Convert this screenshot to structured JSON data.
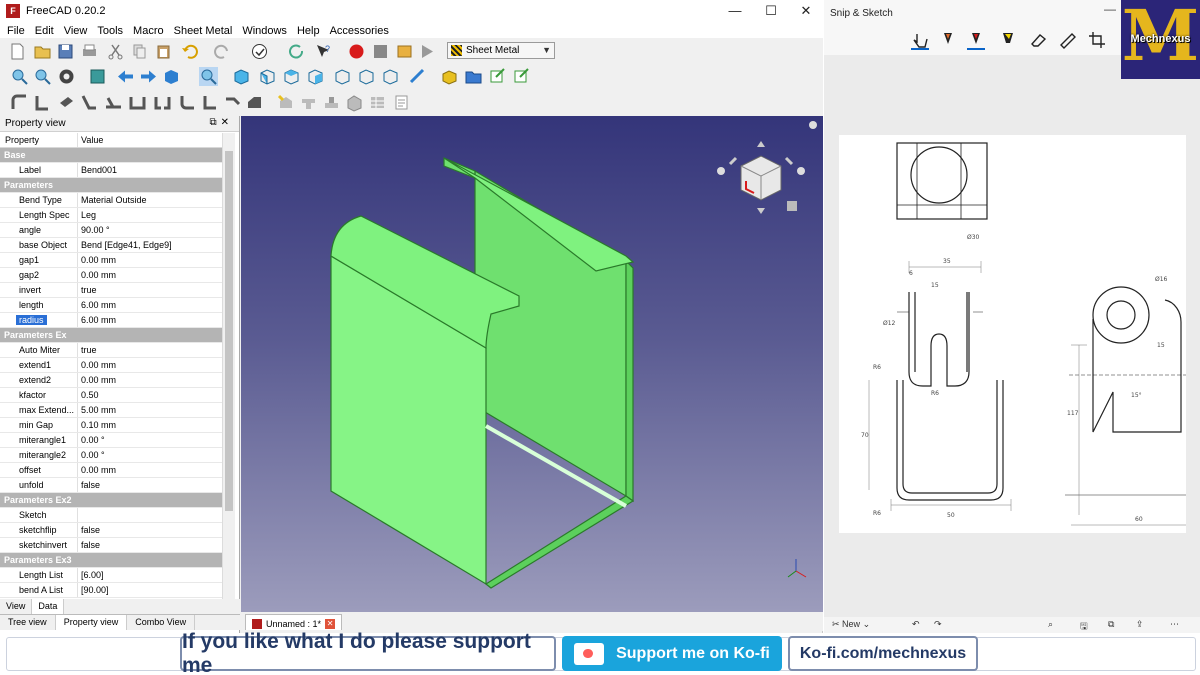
{
  "freecad": {
    "title": "FreeCAD 0.20.2",
    "menu": [
      "File",
      "Edit",
      "View",
      "Tools",
      "Macro",
      "Sheet Metal",
      "Windows",
      "Help",
      "Accessories"
    ],
    "workbench": "Sheet Metal",
    "controls": {
      "minimize": "—",
      "maximize": "☐",
      "close": "✕"
    }
  },
  "property_view": {
    "title": "Property view",
    "col_property": "Property",
    "col_value": "Value",
    "rows": [
      {
        "type": "group",
        "label": "Base"
      },
      {
        "type": "prop",
        "k": "Label",
        "v": "Bend001"
      },
      {
        "type": "group",
        "label": "Parameters"
      },
      {
        "type": "prop",
        "k": "Bend Type",
        "v": "Material Outside"
      },
      {
        "type": "prop",
        "k": "Length Spec",
        "v": "Leg"
      },
      {
        "type": "prop",
        "k": "angle",
        "v": "90.00 °"
      },
      {
        "type": "prop",
        "k": "base Object",
        "v": "Bend [Edge41, Edge9]"
      },
      {
        "type": "prop",
        "k": "gap1",
        "v": "0.00 mm"
      },
      {
        "type": "prop",
        "k": "gap2",
        "v": "0.00 mm"
      },
      {
        "type": "prop",
        "k": "invert",
        "v": "true"
      },
      {
        "type": "prop",
        "k": "length",
        "v": "6.00 mm"
      },
      {
        "type": "prop",
        "k": "radius",
        "v": "6.00 mm",
        "selected": true
      },
      {
        "type": "group",
        "label": "Parameters Ex"
      },
      {
        "type": "prop",
        "k": "Auto Miter",
        "v": "true"
      },
      {
        "type": "prop",
        "k": "extend1",
        "v": "0.00 mm"
      },
      {
        "type": "prop",
        "k": "extend2",
        "v": "0.00 mm"
      },
      {
        "type": "prop",
        "k": "kfactor",
        "v": "0.50"
      },
      {
        "type": "prop",
        "k": "max Extend...",
        "v": "5.00 mm"
      },
      {
        "type": "prop",
        "k": "min Gap",
        "v": "0.10 mm"
      },
      {
        "type": "prop",
        "k": "miterangle1",
        "v": "0.00 °"
      },
      {
        "type": "prop",
        "k": "miterangle2",
        "v": "0.00 °"
      },
      {
        "type": "prop",
        "k": "offset",
        "v": "0.00 mm"
      },
      {
        "type": "prop",
        "k": "unfold",
        "v": "false"
      },
      {
        "type": "group",
        "label": "Parameters Ex2"
      },
      {
        "type": "prop",
        "k": "Sketch",
        "v": ""
      },
      {
        "type": "prop",
        "k": "sketchflip",
        "v": "false"
      },
      {
        "type": "prop",
        "k": "sketchinvert",
        "v": "false"
      },
      {
        "type": "group",
        "label": "Parameters Ex3"
      },
      {
        "type": "prop",
        "k": "Length List",
        "v": "[6.00]"
      },
      {
        "type": "prop",
        "k": "bend A List",
        "v": "[90.00]"
      }
    ],
    "subtabs": [
      "View",
      "Data"
    ],
    "bottom_tabs": [
      "Tree view",
      "Property view",
      "Combo View"
    ]
  },
  "document_tab": "Unnamed : 1*",
  "snip": {
    "title": "Snip & Sketch",
    "bottom_new": "New",
    "drawing_dims": [
      "35",
      "6",
      "15",
      "Ø12",
      "Ø30",
      "R6",
      "R6",
      "R6",
      "70",
      "50",
      "117",
      "60",
      "15°",
      "15",
      "Ø16"
    ]
  },
  "logo": {
    "letter": "M",
    "text": "Mechnexus"
  },
  "banner": {
    "support_text": "If you like what I do please support me",
    "kofi_button": "Support me on Ko-fi",
    "kofi_url": "Ko-fi.com/mechnexus"
  },
  "colors": {
    "viewport_top": "#34357a",
    "model_green": "#7df07d",
    "accent_red": "#d81b1b",
    "kofi_blue": "#1aa4dc"
  }
}
